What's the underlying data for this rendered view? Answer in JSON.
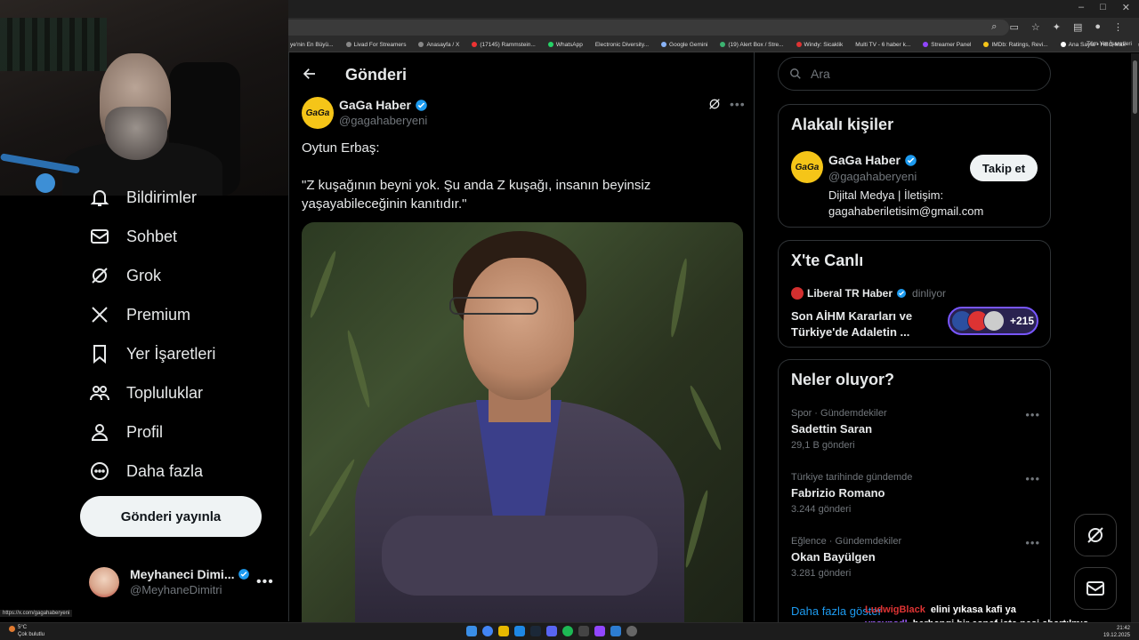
{
  "browser": {
    "bookmarks": [
      "ye'nin En Büyü...",
      "Livad For Streamers",
      "Anasayfa / X",
      "(17145) Rammstein...",
      "WhatsApp",
      "Electronic Diversity...",
      "Google Gemini",
      "(19) Alert Box / Stre...",
      "Windy: Sicaklik",
      "Multi TV - 6 haber k...",
      "Streamer Panel",
      "IMDb: Ratings, Revi...",
      "Ana Sayfa • HBO Max"
    ],
    "bookmarks_overflow": "»",
    "all_bookmarks": "Tüm Yer İşaretleri",
    "status_url": "https://x.com/gagahaberyeni"
  },
  "nav": {
    "items": [
      {
        "label": "Bildirimler",
        "icon": "bell-icon"
      },
      {
        "label": "Sohbet",
        "icon": "mail-icon"
      },
      {
        "label": "Grok",
        "icon": "grok-icon"
      },
      {
        "label": "Premium",
        "icon": "x-logo-icon"
      },
      {
        "label": "Yer İşaretleri",
        "icon": "bookmark-icon"
      },
      {
        "label": "Topluluklar",
        "icon": "people-icon"
      },
      {
        "label": "Profil",
        "icon": "person-icon"
      },
      {
        "label": "Daha fazla",
        "icon": "more-circle-icon"
      }
    ],
    "post_button": "Gönderi yayınla",
    "account": {
      "name": "Meyhaneci Dimi...",
      "handle": "@MeyhaneDimitri",
      "more": "•••"
    }
  },
  "main": {
    "title": "Gönderi",
    "tweet": {
      "author_name": "GaGa Haber",
      "author_handle": "@gagahaberyeni",
      "avatar_text": "GaGa",
      "more": "•••",
      "text": "Oytun Erbaş:\n\n\"Z kuşağının beyni yok. Şu anda Z kuşağı, insanın beyinsiz yaşayabileceğinin kanıtıdır.\""
    }
  },
  "right": {
    "search_placeholder": "Ara",
    "related": {
      "title": "Alakalı kişiler",
      "name": "GaGa Haber",
      "handle": "@gagahaberyeni",
      "avatar_text": "GaGa",
      "bio": "Dijital Medya | İletişim:\ngagahaberiletisim@gmail.com",
      "follow": "Takip et"
    },
    "live": {
      "title": "X'te Canlı",
      "host": "Liberal TR Haber",
      "status": "dinliyor",
      "space_title": "Son AİHM Kararları ve Türkiye'de Adaletin ...",
      "listener_count": "+215"
    },
    "trends": {
      "title": "Neler oluyor?",
      "items": [
        {
          "category": "Spor · Gündemdekiler",
          "name": "Sadettin Saran",
          "count": "29,1 B gönderi"
        },
        {
          "category": "Türkiye tarihinde gündemde",
          "name": "Fabrizio Romano",
          "count": "3.244 gönderi"
        },
        {
          "category": "Eğlence · Gündemdekiler",
          "name": "Okan Bayülgen",
          "count": "3.281 gönderi"
        }
      ],
      "more_icon": "•••",
      "show_more": "Daha fazla göster"
    }
  },
  "chat": [
    {
      "user": "LudwigBlack",
      "message": "elini yıkasa kafi ya"
    },
    {
      "user": "vnsvnsdl",
      "message": "herhangi bir esnaf işte nesi abartılmış"
    }
  ],
  "taskbar": {
    "weather_temp": "5°C",
    "weather_desc": "Çok bulutlu",
    "time": "21:42",
    "date": "19.12.2025"
  },
  "colors": {
    "accent": "#1d9bf0",
    "background": "#000000",
    "text": "#e7e9ea",
    "muted": "#71767b",
    "border": "#2f3336",
    "verified": "#1d9bf0",
    "live_pill": "#7856ff"
  }
}
